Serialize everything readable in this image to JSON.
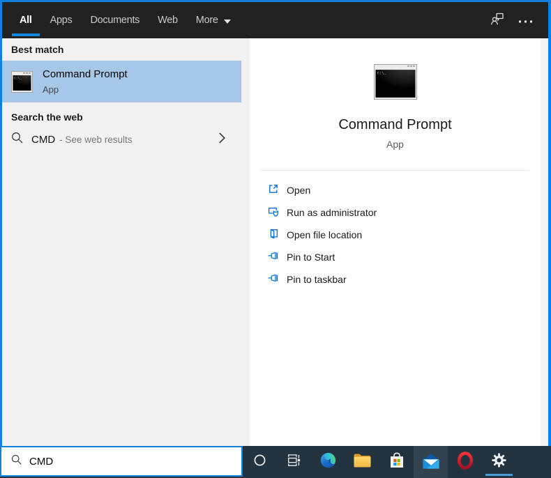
{
  "colors": {
    "accent": "#0f80dc",
    "header_bg": "#212121",
    "left_panel_bg": "#f2f2f2",
    "best_match_highlight": "#a6c7e8",
    "taskbar_bg": "#233440",
    "action_icon_blue": "#0b6fce",
    "running_indicator": "#4c9cd8"
  },
  "header": {
    "tabs": [
      {
        "label": "All",
        "active": true
      },
      {
        "label": "Apps",
        "active": false
      },
      {
        "label": "Documents",
        "active": false
      },
      {
        "label": "Web",
        "active": false
      },
      {
        "label": "More",
        "active": false,
        "caret": "caret-down-icon"
      }
    ],
    "icons": [
      "feedback-icon",
      "ellipsis-icon"
    ]
  },
  "left": {
    "best_match_header": "Best match",
    "best_match": {
      "title": "Command Prompt",
      "subtitle": "App",
      "icon": "command-prompt-icon"
    },
    "search_web_header": "Search the web",
    "web_result": {
      "query": "CMD",
      "suffix": "- See web results",
      "icon": "search-icon",
      "chevron": "chevron-right-icon"
    }
  },
  "right": {
    "app": {
      "title": "Command Prompt",
      "subtitle": "App",
      "icon": "command-prompt-icon"
    },
    "actions": [
      {
        "label": "Open",
        "icon": "open-icon"
      },
      {
        "label": "Run as administrator",
        "icon": "admin-shield-icon"
      },
      {
        "label": "Open file location",
        "icon": "file-location-icon"
      },
      {
        "label": "Pin to Start",
        "icon": "pin-icon"
      },
      {
        "label": "Pin to taskbar",
        "icon": "pin-icon"
      }
    ]
  },
  "search": {
    "value": "CMD",
    "icon": "search-icon"
  },
  "taskbar": {
    "items": [
      {
        "name": "cortana",
        "running": false,
        "highlighted": false
      },
      {
        "name": "task-view",
        "running": false,
        "highlighted": false
      },
      {
        "name": "edge",
        "running": false,
        "highlighted": false
      },
      {
        "name": "file-explorer",
        "running": false,
        "highlighted": false
      },
      {
        "name": "store",
        "running": false,
        "highlighted": false
      },
      {
        "name": "mail",
        "running": false,
        "highlighted": true
      },
      {
        "name": "opera",
        "running": false,
        "highlighted": false
      },
      {
        "name": "settings",
        "running": true,
        "highlighted": false
      }
    ]
  }
}
